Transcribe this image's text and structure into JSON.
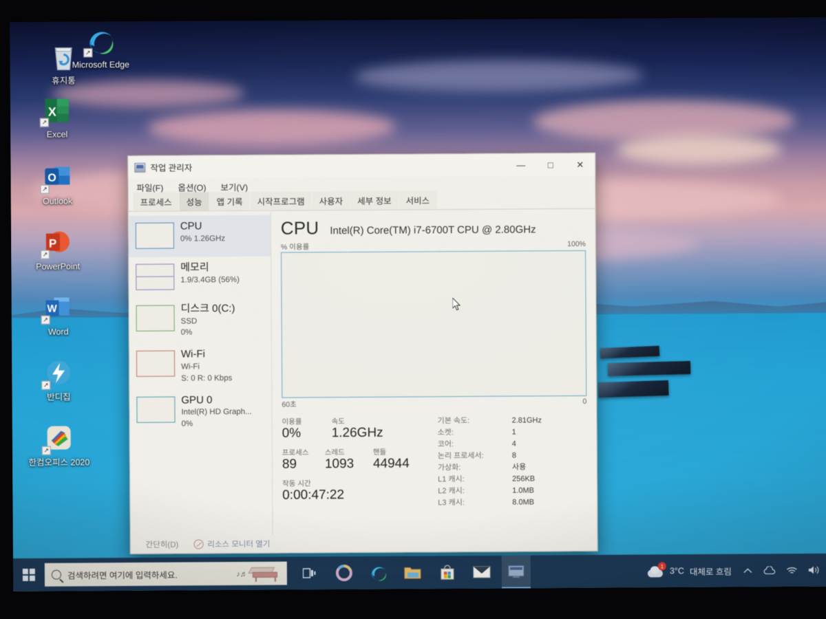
{
  "desktop": {
    "icons": [
      {
        "name": "recycle-bin",
        "label": "휴지통"
      },
      {
        "name": "microsoft-edge",
        "label": "Microsoft Edge"
      },
      {
        "name": "excel",
        "label": "Excel"
      },
      {
        "name": "outlook",
        "label": "Outlook"
      },
      {
        "name": "powerpoint",
        "label": "PowerPoint"
      },
      {
        "name": "word",
        "label": "Word"
      },
      {
        "name": "bandizip",
        "label": "반디집"
      },
      {
        "name": "hancom-office",
        "label": "한컴오피스 2020"
      }
    ]
  },
  "taskmgr": {
    "title": "작업 관리자",
    "window_buttons": {
      "minimize": "—",
      "maximize": "□",
      "close": "✕"
    },
    "menu": [
      "파일(F)",
      "옵션(O)",
      "보기(V)"
    ],
    "tabs": [
      {
        "label": "프로세스",
        "active": false
      },
      {
        "label": "성능",
        "active": true
      },
      {
        "label": "앱 기록",
        "active": false
      },
      {
        "label": "시작프로그램",
        "active": false
      },
      {
        "label": "사용자",
        "active": false
      },
      {
        "label": "세부 정보",
        "active": false
      },
      {
        "label": "서비스",
        "active": false
      }
    ],
    "sidebar": [
      {
        "title": "CPU",
        "sub1": "0% 1.26GHz",
        "sub2": "",
        "active": true,
        "border": "#4a86b8"
      },
      {
        "title": "메모리",
        "sub1": "1.9/3.4GB (56%)",
        "sub2": "",
        "active": false,
        "border": "#8a7fb5"
      },
      {
        "title": "디스크 0(C:)",
        "sub1": "SSD",
        "sub2": "0%",
        "active": false,
        "border": "#6fa35a"
      },
      {
        "title": "Wi-Fi",
        "sub1": "Wi-Fi",
        "sub2": "S: 0 R: 0 Kbps",
        "active": false,
        "border": "#c2705f"
      },
      {
        "title": "GPU 0",
        "sub1": "Intel(R) HD Graph...",
        "sub2": "0%",
        "active": false,
        "border": "#4f9aa8"
      }
    ],
    "detail": {
      "heading": "CPU",
      "model": "Intel(R) Core(TM) i7-6700T CPU @ 2.80GHz",
      "graph_axis_label": "% 이용률",
      "graph_max": "100%",
      "graph_time_span": "60초",
      "graph_time_zero": "0",
      "stats_left": [
        {
          "labels": [
            "이용률",
            "속도"
          ],
          "values": [
            "0%",
            "1.26GHz"
          ]
        },
        {
          "labels": [
            "프로세스",
            "스레드",
            "핸들"
          ],
          "values": [
            "89",
            "1093",
            "44944"
          ]
        },
        {
          "labels": [
            "작동 시간"
          ],
          "values": [
            "0:00:47:22"
          ]
        }
      ],
      "stats_right": [
        {
          "key": "기본 속도:",
          "value": "2.81GHz"
        },
        {
          "key": "소켓:",
          "value": "1"
        },
        {
          "key": "코어:",
          "value": "4"
        },
        {
          "key": "논리 프로세서:",
          "value": "8"
        },
        {
          "key": "가상화:",
          "value": "사용"
        },
        {
          "key": "L1 캐시:",
          "value": "256KB"
        },
        {
          "key": "L2 캐시:",
          "value": "1.0MB"
        },
        {
          "key": "L3 캐시:",
          "value": "8.0MB"
        }
      ]
    },
    "footer": {
      "simple_view": "간단히(D)",
      "resource_monitor": "리소스 모니터 열기"
    }
  },
  "taskbar": {
    "search_placeholder": "검색하려면 여기에 입력하세요.",
    "icons": [
      {
        "name": "task-view",
        "active": false
      },
      {
        "name": "cortana",
        "active": false
      },
      {
        "name": "microsoft-edge",
        "active": false
      },
      {
        "name": "file-explorer",
        "active": false
      },
      {
        "name": "microsoft-store",
        "active": false
      },
      {
        "name": "mail",
        "active": false
      },
      {
        "name": "task-manager",
        "active": true
      }
    ],
    "tray": {
      "temperature": "3°C",
      "condition": "대체로 흐림",
      "badge": "1"
    }
  },
  "colors": {
    "accent": "#4a86b8",
    "window_bg": "#f0efe9",
    "taskbar_bg": "#1c324e",
    "lake": "#2aa8d8"
  }
}
